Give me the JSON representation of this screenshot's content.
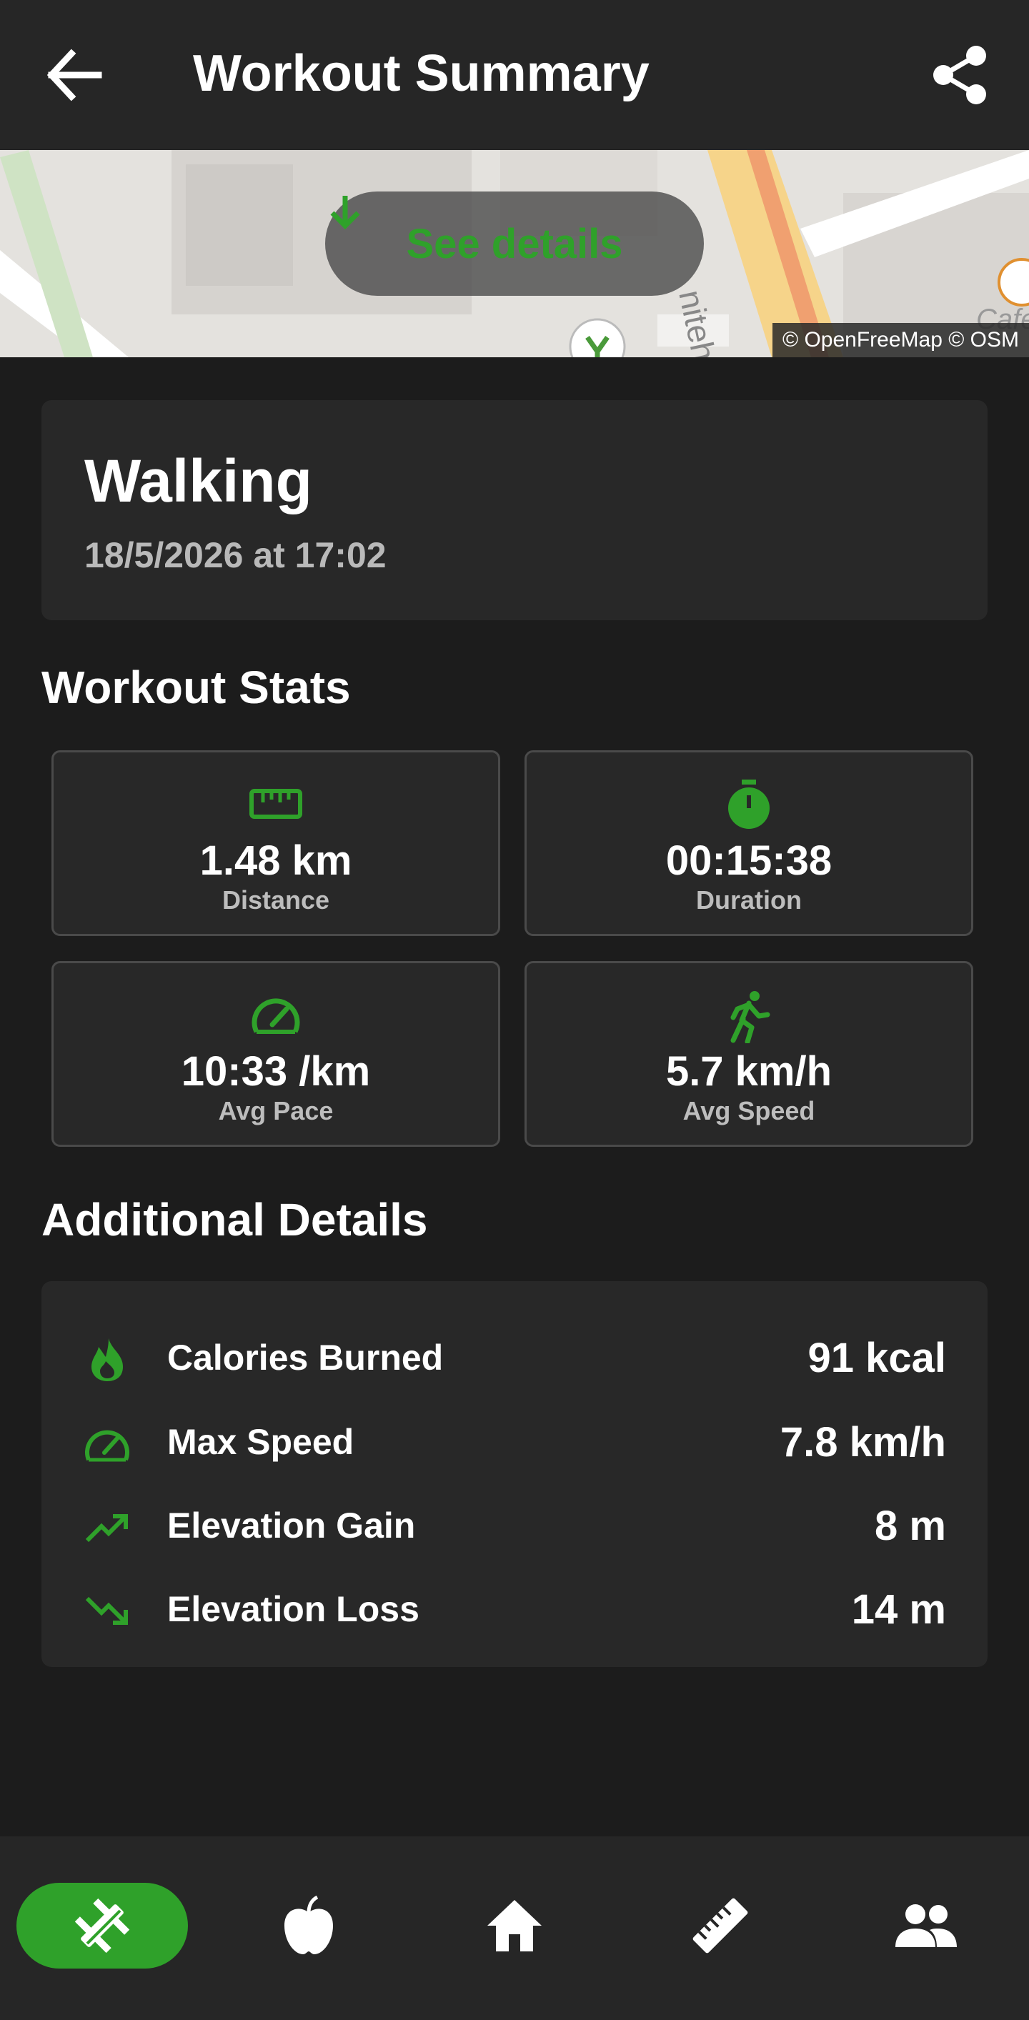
{
  "app_bar": {
    "title": "Workout Summary",
    "back_icon": "arrow-back-icon",
    "share_icon": "share-icon"
  },
  "map": {
    "see_details_label": "See details",
    "attribution": "© OpenFreeMap © OSM",
    "street_label": "nitehall",
    "poi_label": "Cafe"
  },
  "activity": {
    "name": "Walking",
    "datetime": "18/5/2026 at 17:02"
  },
  "stats": {
    "section_title": "Workout Stats",
    "items": [
      {
        "icon": "ruler-icon",
        "value": "1.48 km",
        "label": "Distance"
      },
      {
        "icon": "stopwatch-icon",
        "value": "00:15:38",
        "label": "Duration"
      },
      {
        "icon": "speedometer-icon",
        "value": "10:33 /km",
        "label": "Avg Pace"
      },
      {
        "icon": "running-icon",
        "value": "5.7 km/h",
        "label": "Avg Speed"
      }
    ]
  },
  "details": {
    "section_title": "Additional Details",
    "items": [
      {
        "icon": "flame-icon",
        "label": "Calories Burned",
        "value": "91 kcal"
      },
      {
        "icon": "speedometer-icon",
        "label": "Max Speed",
        "value": "7.8 km/h"
      },
      {
        "icon": "trending-up-icon",
        "label": "Elevation Gain",
        "value": "8 m"
      },
      {
        "icon": "trending-down-icon",
        "label": "Elevation Loss",
        "value": "14 m"
      }
    ]
  },
  "bottom_nav": {
    "items": [
      {
        "icon": "dumbbell-icon",
        "active": true
      },
      {
        "icon": "apple-icon",
        "active": false
      },
      {
        "icon": "home-icon",
        "active": false
      },
      {
        "icon": "ruler-icon",
        "active": false
      },
      {
        "icon": "people-icon",
        "active": false
      }
    ]
  },
  "colors": {
    "accent": "#2fa12a",
    "background": "#1c1c1c",
    "surface": "#282828",
    "app_bar": "#262626"
  }
}
